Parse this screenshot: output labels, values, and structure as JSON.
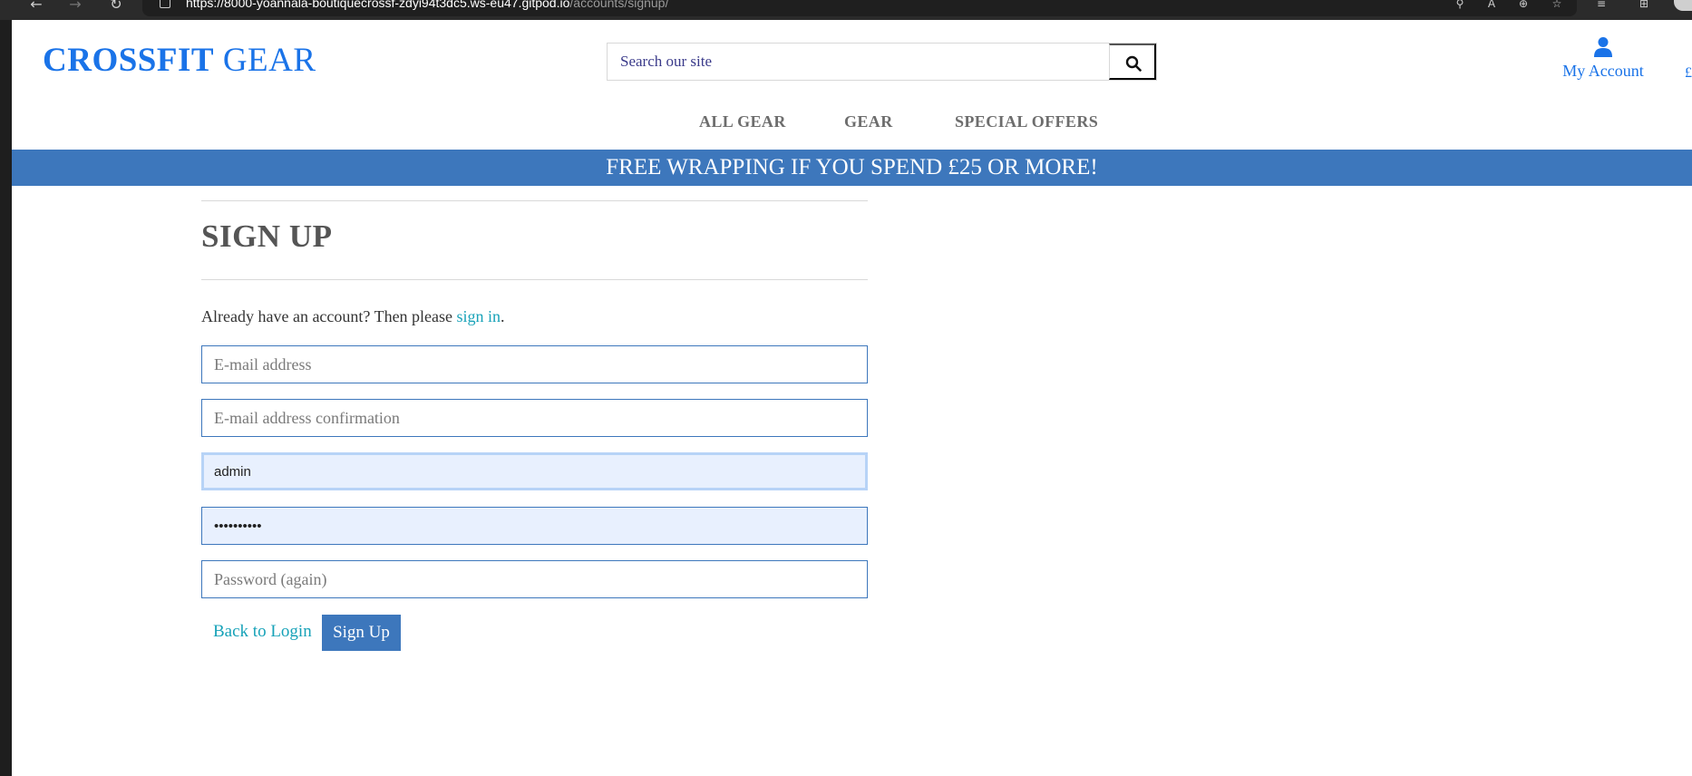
{
  "browser": {
    "url_host": "https://8000-yoannala-boutiquecrossf-zdyi94t3dc5.ws-eu47.gitpod.io",
    "url_path": "/accounts/signup/"
  },
  "header": {
    "brand_bold": "CROSSFIT",
    "brand_light": "GEAR",
    "search_placeholder": "Search our site",
    "account_label": "My Account",
    "bag_partial": "£"
  },
  "nav": {
    "items": [
      {
        "label": "ALL GEAR"
      },
      {
        "label": "GEAR"
      },
      {
        "label": "SPECIAL OFFERS"
      }
    ]
  },
  "banner": {
    "text": "FREE WRAPPING IF YOU SPEND £25 OR MORE!"
  },
  "form": {
    "title": "SIGN UP",
    "intro_text": "Already have an account? Then please ",
    "intro_link": "sign in",
    "intro_end": ".",
    "email_placeholder": "E-mail address",
    "email2_placeholder": "E-mail address confirmation",
    "username_value": "admin",
    "password_value": "••••••••••",
    "password2_placeholder": "Password (again)",
    "back_label": "Back to Login",
    "submit_label": "Sign Up"
  },
  "colors": {
    "brand": "#1a73e8",
    "banner": "#3d77bc",
    "link": "#17a2b8"
  }
}
